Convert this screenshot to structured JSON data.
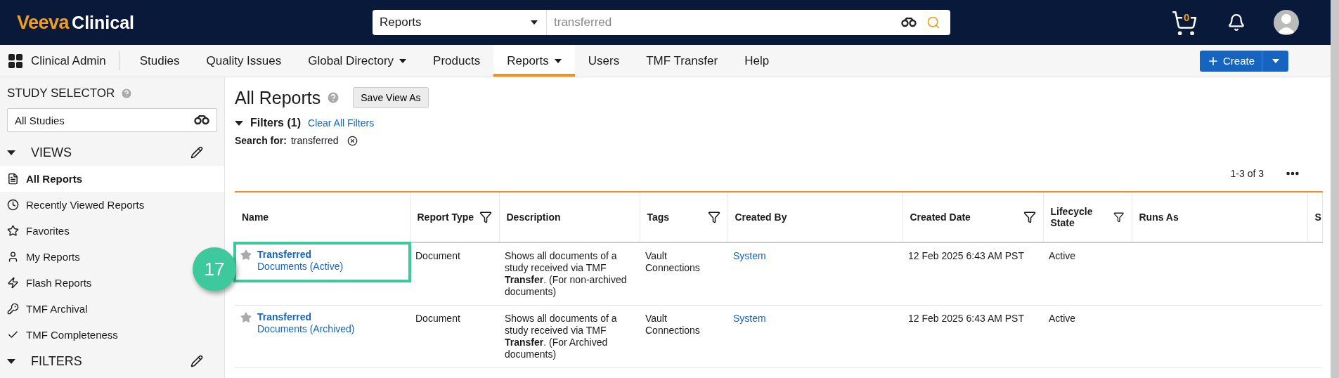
{
  "header": {
    "logo": {
      "brand": "Veeva",
      "product": "Clinical"
    },
    "search": {
      "scope": "Reports",
      "value": "transferred"
    },
    "cart_count": "0"
  },
  "nav": {
    "app": "Clinical Admin",
    "items": [
      {
        "label": "Studies",
        "dropdown": false,
        "selected": false
      },
      {
        "label": "Quality Issues",
        "dropdown": false,
        "selected": false
      },
      {
        "label": "Global Directory",
        "dropdown": true,
        "selected": false
      },
      {
        "label": "Products",
        "dropdown": false,
        "selected": false
      },
      {
        "label": "Reports",
        "dropdown": true,
        "selected": true
      },
      {
        "label": "Users",
        "dropdown": false,
        "selected": false
      },
      {
        "label": "TMF Transfer",
        "dropdown": false,
        "selected": false
      },
      {
        "label": "Help",
        "dropdown": false,
        "selected": false
      }
    ],
    "create_button": "Create"
  },
  "sidebar": {
    "study_selector": {
      "title": "STUDY SELECTOR",
      "value": "All Studies"
    },
    "views": {
      "title": "VIEWS",
      "expanded": true,
      "items": [
        {
          "label": "All Reports",
          "selected": true
        },
        {
          "label": "Recently Viewed Reports",
          "selected": false
        },
        {
          "label": "Favorites",
          "selected": false
        },
        {
          "label": "My Reports",
          "selected": false
        },
        {
          "label": "Flash Reports",
          "selected": false
        },
        {
          "label": "TMF Archival",
          "selected": false
        },
        {
          "label": "TMF Completeness",
          "selected": false
        }
      ]
    },
    "filters": {
      "title": "FILTERS",
      "expanded": true
    }
  },
  "main": {
    "title": "All Reports",
    "save_view_button": "Save View As",
    "filters": {
      "title": "Filters (1)",
      "expanded": true,
      "clear_link": "Clear All Filters",
      "search_label": "Search for:",
      "search_value": "transferred"
    },
    "pagination": "1-3 of 3",
    "table": {
      "columns": [
        {
          "label": "Name",
          "filterable": false
        },
        {
          "label": "Report Type",
          "filterable": true
        },
        {
          "label": "Description",
          "filterable": false
        },
        {
          "label": "Tags",
          "filterable": true
        },
        {
          "label": "Created By",
          "filterable": false
        },
        {
          "label": "Created Date",
          "filterable": true
        },
        {
          "label": "Lifecycle State",
          "filterable": true
        },
        {
          "label": "Runs As",
          "filterable": false
        },
        {
          "label": "S",
          "filterable": false
        }
      ],
      "rows": [
        {
          "name_title": "Transferred",
          "name_rest": "Documents (Active)",
          "favorite": false,
          "report_type": "Document",
          "description": "Shows all documents of a study received via TMF **Transfer**. (For non-archived documents)",
          "tags": "Vault Connections",
          "created_by": "System",
          "created_date": "12 Feb 2025 6:43 AM PST",
          "lifecycle_state": "Active",
          "callout": "17"
        },
        {
          "name_title": "Transferred",
          "name_rest": "Documents (Archived)",
          "favorite": false,
          "report_type": "Document",
          "description": "Shows all documents of a study received via TMF **Transfer**. (For Archived documents)",
          "tags": "Vault Connections",
          "created_by": "System",
          "created_date": "12 Feb 2025 6:43 AM PST",
          "lifecycle_state": "Active"
        }
      ]
    }
  }
}
